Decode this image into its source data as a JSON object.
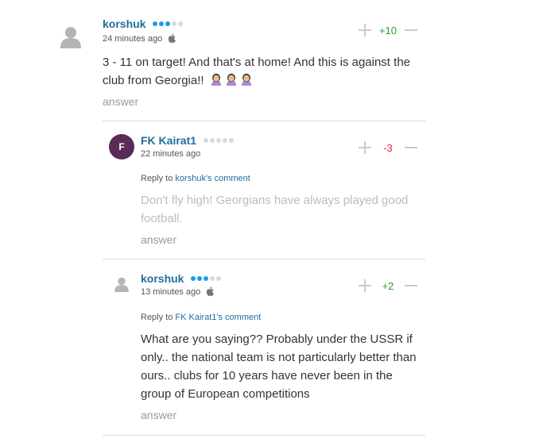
{
  "comments": [
    {
      "username": "korshuk",
      "rank_active": 3,
      "time": "24 minutes ago",
      "text": "3 - 11 on target! And that's at home! And this is against the club from Georgia!!",
      "emoji": [
        "woman-facepalming",
        "woman-facepalming",
        "woman-facepalming"
      ],
      "score": "+10",
      "answer": "answer",
      "device": "apple-icon"
    },
    {
      "username": "FK Kairat1",
      "avatar_letter": "F",
      "rank_active": 0,
      "time": "22 minutes ago",
      "reply_prefix": "Reply to",
      "reply_link": "korshuk's comment",
      "text": "Don't fly high! Georgians have always played good football.",
      "score": "-3",
      "answer": "answer"
    },
    {
      "username": "korshuk",
      "rank_active": 3,
      "time": "13 minutes ago",
      "reply_prefix": "Reply to",
      "reply_link": "FK Kairat1's comment",
      "text": "What are you saying?? Probably under the USSR if only.. the national team is not particularly better than ours.. clubs for 10 years have never been in the group of European competitions",
      "score": "+2",
      "answer": "answer",
      "device": "apple-icon"
    }
  ],
  "colors": {
    "username": "#1f6e9a",
    "rank_on": "#1e9be8",
    "rank_off": "#d9d9d9",
    "score_positive": "#2a9d2a",
    "score_negative": "#e0263a",
    "avatar_letter_bg": "#5a2b57"
  }
}
